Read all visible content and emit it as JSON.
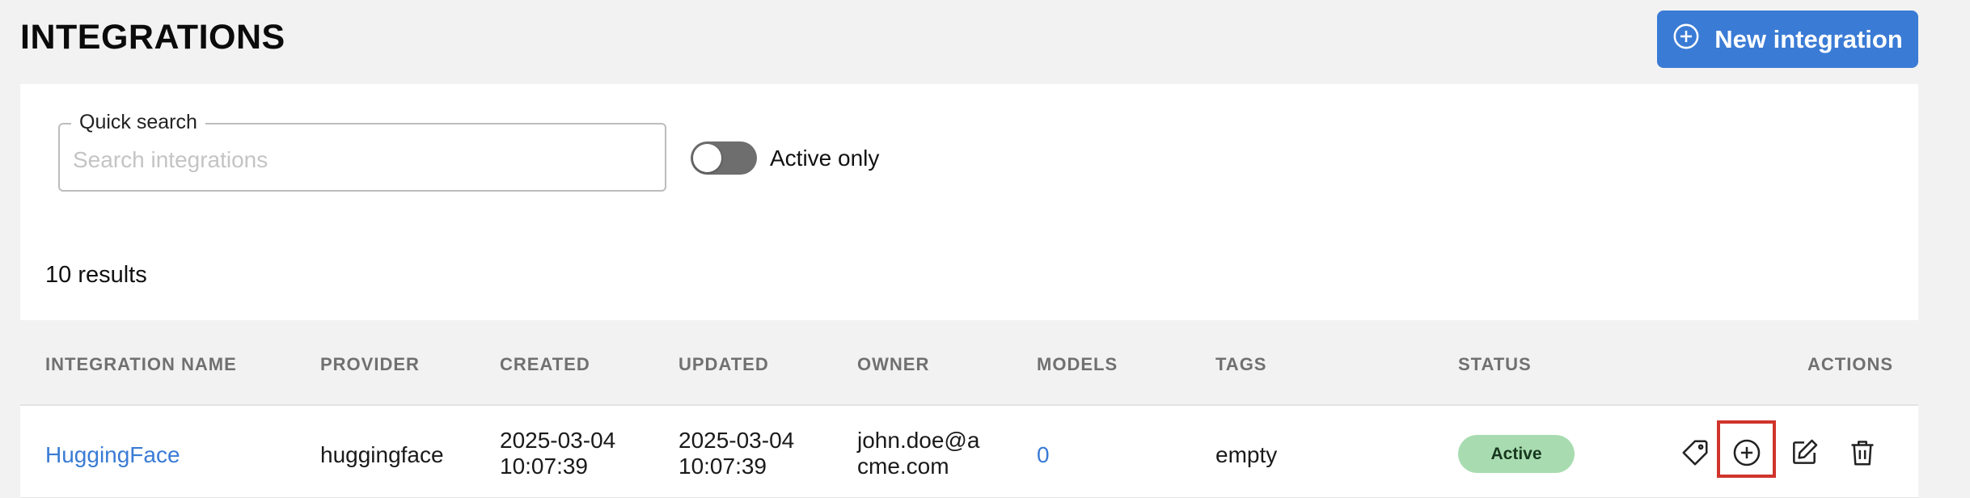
{
  "header": {
    "title": "INTEGRATIONS",
    "new_button_label": "New integration"
  },
  "filters": {
    "search_label": "Quick search",
    "search_placeholder": "Search integrations",
    "search_value": "",
    "active_only_label": "Active only",
    "active_only_on": false
  },
  "results_text": "10 results",
  "table": {
    "columns": [
      "INTEGRATION NAME",
      "PROVIDER",
      "CREATED",
      "UPDATED",
      "OWNER",
      "MODELS",
      "TAGS",
      "STATUS",
      "ACTIONS"
    ],
    "rows": [
      {
        "name": "HuggingFace",
        "provider": "huggingface",
        "created_date": "2025-03-04",
        "created_time": "10:07:39",
        "updated_date": "2025-03-04",
        "updated_time": "10:07:39",
        "owner_line1": "john.doe@a",
        "owner_line2": "cme.com",
        "models": "0",
        "tags": "empty",
        "status": "Active"
      }
    ]
  },
  "icons": {
    "new": "plus-circle-icon",
    "actions": [
      "tag-icon",
      "plus-circle-icon",
      "edit-icon",
      "trash-icon"
    ]
  },
  "colors": {
    "accent": "#3a7bd5",
    "status_active_bg": "#a8dcb0",
    "highlight": "#d0342c"
  }
}
